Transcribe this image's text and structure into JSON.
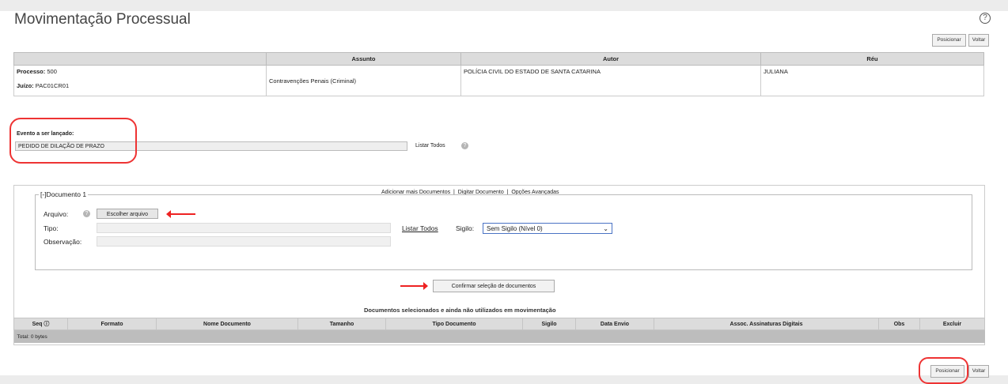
{
  "page_title": "Movimentação Processual",
  "toolbar": {
    "position_label": "Posicionar",
    "back_label": "Voltar"
  },
  "process_table": {
    "headers": [
      "",
      "Assunto",
      "Autor",
      "Réu"
    ],
    "processo_label": "Processo:",
    "processo_value": "500",
    "juizo_label": "Juízo:",
    "juizo_value": "PAC01CR01",
    "assunto": "Contravenções Penais (Criminal)",
    "autor": "POLÍCIA CIVIL DO ESTADO DE SANTA CATARINA",
    "reu": "JULIANA"
  },
  "evento": {
    "label": "Evento a ser lançado:",
    "value": "PEDIDO DE DILAÇÃO DE PRAZO",
    "listar_todos": "Listar Todos"
  },
  "doc_links": {
    "add": "Adicionar mais Documentos",
    "sep": "|",
    "digitar": "Digitar Documento",
    "opcoes": "Opções Avançadas"
  },
  "document": {
    "legend": "[-]Documento 1",
    "arquivo_label": "Arquivo:",
    "choose_file": "Escolher arquivo",
    "tipo_label": "Tipo:",
    "observacao_label": "Observação:",
    "listar_todos": "Listar Todos",
    "sigilo_label": "Sigilo:",
    "sigilo_value": "Sem Sigilo (Nível 0)"
  },
  "confirm_button": "Confirmar seleção de documentos",
  "selected_docs": {
    "title": "Documentos selecionados e ainda não utilizados em movimentação",
    "columns": [
      "Seq",
      "Formato",
      "Nome Documento",
      "Tamanho",
      "Tipo Documento",
      "Sigilo",
      "Data Envio",
      "Assoc. Assinaturas Digitais",
      "Obs",
      "Excluir"
    ],
    "total": "Total: 0 bytes"
  },
  "colors": {
    "highlight": "#e33333",
    "select_border": "#4a73c4"
  }
}
